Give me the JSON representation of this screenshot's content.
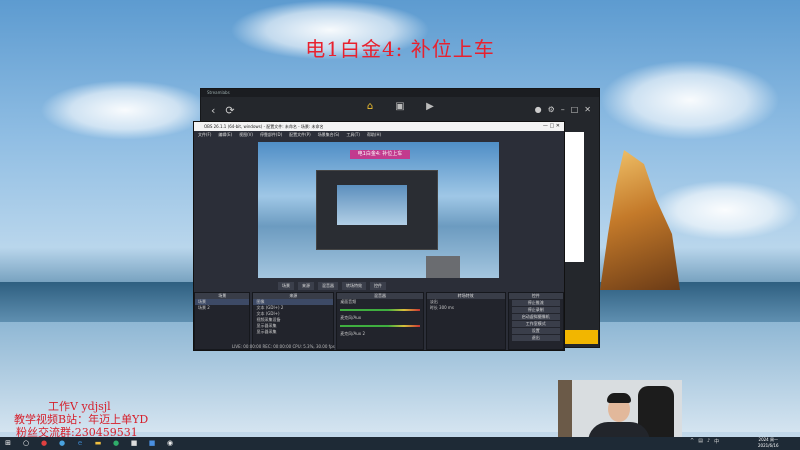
{
  "overlay": {
    "title": "电1白金4: 补位上车",
    "info_lines": [
      "工作V ydjsjl",
      "教学视频B站：年迈上单YD",
      "粉丝交流群:230459531"
    ]
  },
  "studio_window": {
    "title": "Streamlabs",
    "nav_back": "‹",
    "nav_refresh": "⟳",
    "active_label": "主页"
  },
  "obs_window": {
    "title": "OBS 26.1.1 (64-bit, windows) - 配置文件: 未命名 - 场景: 未命名",
    "menu": [
      "文件(F)",
      "编辑(E)",
      "视图(V)",
      "停靠部件(D)",
      "配置文件(P)",
      "场景集合(S)",
      "工具(T)",
      "帮助(H)"
    ],
    "preview_title": "电1白金4: 补位上车",
    "tabs": [
      "场景",
      "来源",
      "混音器",
      "转场特效",
      "控件"
    ],
    "scenes": [
      "场景",
      "场景 2"
    ],
    "sources": [
      "图像",
      "文本 (GDI+) 2",
      "文本 (GDI+)",
      "视频采集设备",
      "显示器采集",
      "显示器采集"
    ],
    "mixer": [
      "桌面音频",
      "麦克风/Aux",
      "麦克风/Aux 2"
    ],
    "transition": [
      "淡出",
      "时长 300 ms"
    ],
    "controls": [
      "停止推流",
      "停止录制",
      "启动虚拟摄像机",
      "工作室模式",
      "设置",
      "退出"
    ],
    "status": "LIVE: 00:00:00   REC: 00:00:00   CPU: 5.3%, 30.00 fps"
  },
  "taskbar": {
    "clock_time": "2024 周一",
    "clock_date": "2021/6/16"
  },
  "colors": {
    "overlay_red": "#e8212e",
    "accent_yellow": "#f2b600",
    "taskbar": "#1e2a36"
  }
}
